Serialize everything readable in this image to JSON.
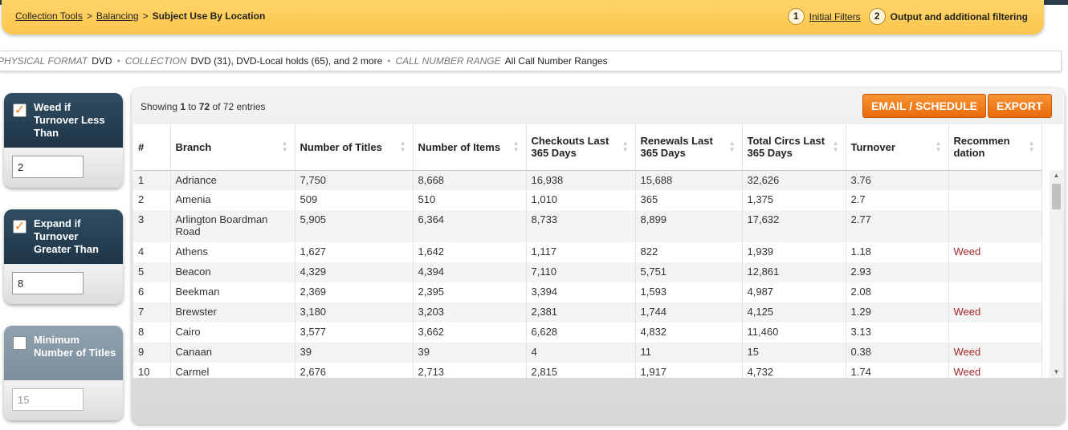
{
  "breadcrumb": {
    "items": [
      "Collection Tools",
      "Balancing"
    ],
    "current": "Subject Use By Location",
    "sep": ">"
  },
  "steps": [
    {
      "num": "1",
      "label": "Initial Filters"
    },
    {
      "num": "2",
      "label": "Output and additional filtering"
    }
  ],
  "filters": {
    "format_label": "PHYSICAL FORMAT",
    "format_value": "DVD",
    "collection_label": "COLLECTION",
    "collection_value": "DVD (31), DVD-Local holds (65), and 2 more",
    "callnum_label": "CALL NUMBER RANGE",
    "callnum_value": "All Call Number Ranges",
    "dot": "•"
  },
  "panels": {
    "weed": {
      "label": "Weed if Turnover Less Than",
      "checked": true,
      "value": "2"
    },
    "expand": {
      "label": "Expand if Turnover Greater Than",
      "checked": true,
      "value": "8"
    },
    "minimum": {
      "label": "Minimum Number of Titles",
      "checked": false,
      "value": "15"
    }
  },
  "showing": {
    "prefix": "Showing",
    "from": "1",
    "to_word": "to",
    "to": "72",
    "of_text": "of 72 entries"
  },
  "buttons": {
    "email": "EMAIL / SCHEDULE",
    "export": "EXPORT"
  },
  "table": {
    "headers": [
      "#",
      "Branch",
      "Number of Titles",
      "Number of Items",
      "Checkouts Last 365 Days",
      "Renewals Last 365 Days",
      "Total Circs Last 365 Days",
      "Turnover",
      "Recommen dation"
    ],
    "rows": [
      [
        "1",
        "Adriance",
        "7,750",
        "8,668",
        "16,938",
        "15,688",
        "32,626",
        "3.76",
        ""
      ],
      [
        "2",
        "Amenia",
        "509",
        "510",
        "1,010",
        "365",
        "1,375",
        "2.7",
        ""
      ],
      [
        "3",
        "Arlington Boardman Road",
        "5,905",
        "6,364",
        "8,733",
        "8,899",
        "17,632",
        "2.77",
        ""
      ],
      [
        "4",
        "Athens",
        "1,627",
        "1,642",
        "1,117",
        "822",
        "1,939",
        "1.18",
        "Weed"
      ],
      [
        "5",
        "Beacon",
        "4,329",
        "4,394",
        "7,110",
        "5,751",
        "12,861",
        "2.93",
        ""
      ],
      [
        "6",
        "Beekman",
        "2,369",
        "2,395",
        "3,394",
        "1,593",
        "4,987",
        "2.08",
        ""
      ],
      [
        "7",
        "Brewster",
        "3,180",
        "3,203",
        "2,381",
        "1,744",
        "4,125",
        "1.29",
        "Weed"
      ],
      [
        "8",
        "Cairo",
        "3,577",
        "3,662",
        "6,628",
        "4,832",
        "11,460",
        "3.13",
        ""
      ],
      [
        "9",
        "Canaan",
        "39",
        "39",
        "4",
        "11",
        "15",
        "0.38",
        "Weed"
      ],
      [
        "10",
        "Carmel",
        "2,676",
        "2,713",
        "2,815",
        "1,917",
        "4,732",
        "1.74",
        "Weed"
      ]
    ]
  },
  "colors": {
    "accent": "#ea6a0c",
    "weed": "#a4272a",
    "panel_dark": "#1f3547",
    "header_yellow": "#fbc64c"
  }
}
